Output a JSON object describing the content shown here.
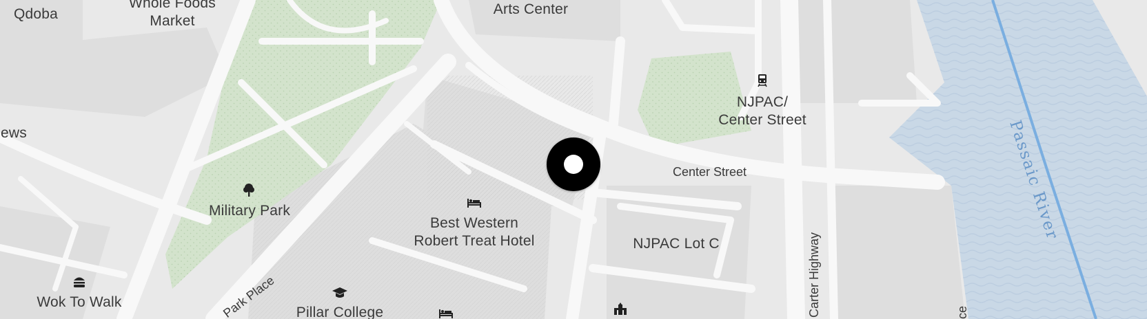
{
  "colors": {
    "land": "#e9e9e9",
    "block": "#dcdcdc",
    "road": "#f7f7f7",
    "park": "#d3e3cc",
    "water": "#c9d8e6",
    "river_line": "#7aaee0",
    "label": "#3a3a3a",
    "marker": "#000000"
  },
  "places": {
    "qdoba": "Qdoba",
    "whole_foods_1": "Whole Foods",
    "whole_foods_2": "Market",
    "arts_center": "Arts Center",
    "news_fragment": "ews",
    "njpac_station_1": "NJPAC/",
    "njpac_station_2": "Center Street",
    "military_park": "Military Park",
    "best_western_1": "Best Western",
    "best_western_2": "Robert Treat Hotel",
    "njpac_lot_c": "NJPAC Lot C",
    "wok_to_walk": "Wok To Walk",
    "pillar_college": "Pillar College"
  },
  "streets": {
    "center_street": "Center Street",
    "park_place": "Park Place",
    "carter_highway": "Carter Highway",
    "edge_fragment": "ce"
  },
  "water": {
    "passaic_river": "Passaic River"
  },
  "icons": {
    "train": "train-icon",
    "tree": "tree-icon",
    "hotel": "hotel-icon",
    "restaurant": "burger-icon",
    "college": "graduation-cap-icon",
    "museum": "museum-icon",
    "marker": "location-marker-icon"
  }
}
